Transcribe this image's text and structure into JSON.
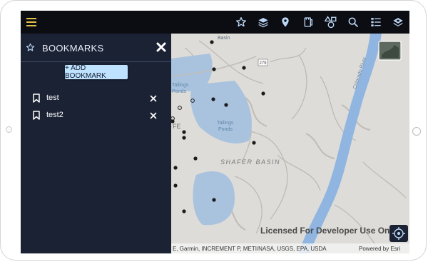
{
  "panel": {
    "title": "BOOKMARKS",
    "add_label": "+ ADD BOOKMARK",
    "bookmarks": [
      {
        "name": "test"
      },
      {
        "name": "test2"
      }
    ]
  },
  "map": {
    "labels": {
      "basin_top": "Basin",
      "tailings_ponds_left_1": "Tailings",
      "tailings_ponds_left_2": "Ponds",
      "tailings_ponds_center_1": "Tailings",
      "tailings_ponds_center_2": "Ponds",
      "shafer_basin": "SHAFER BASIN",
      "river": "Colorado River",
      "road_shield": "279",
      "fe": "FE"
    },
    "watermark": "Licensed For Developer Use Only",
    "attribution": "E, Garmin, INCREMENT P, METI/NASA, USGS, EPA, USDA",
    "powered_by": "Powered by Esri"
  },
  "colors": {
    "toolbar_bg": "#0b0d12",
    "panel_bg": "#1a2233",
    "accent": "#bfe2ff",
    "menu_icon": "#e2c14a",
    "toolbar_icon": "#bcd6f5",
    "water": "#a9c3df",
    "river": "#8fb5e0"
  },
  "toolbar": {
    "icons": [
      "menu-icon",
      "star-icon",
      "layers-icon",
      "location-pin-icon",
      "print-icon",
      "shapes-icon",
      "search-icon",
      "legend-list-icon",
      "basemap-icon"
    ]
  }
}
